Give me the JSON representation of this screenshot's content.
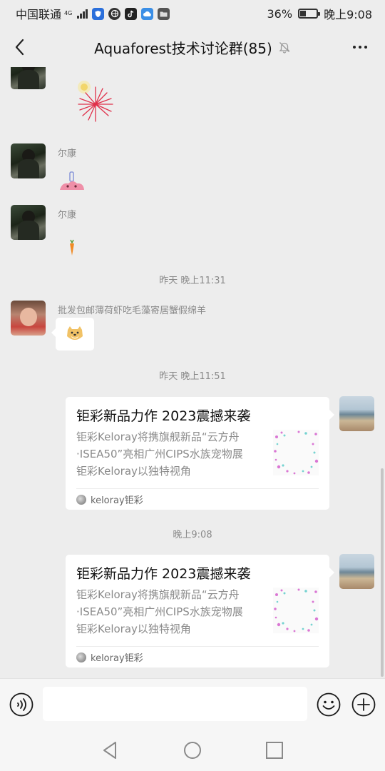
{
  "status_bar": {
    "carrier": "中国联通",
    "network": "4G",
    "battery_percent": "36%",
    "battery_level": 0.36,
    "time": "晚上9:08",
    "app_icons": [
      "shield-app-icon",
      "browser-app-icon",
      "tiktok-app-icon",
      "cloud-app-icon",
      "folder-app-icon"
    ]
  },
  "header": {
    "title": "Aquaforest技术讨论群(85)",
    "icons": [
      "back-icon",
      "mute-bell-icon",
      "more-icon"
    ]
  },
  "messages": [
    {
      "type": "sticker",
      "side": "left",
      "sticker": "firework-sticker"
    },
    {
      "type": "sticker",
      "side": "left",
      "sender": "尔康",
      "sticker": "pink-blob-sticker"
    },
    {
      "type": "sticker",
      "side": "left",
      "sender": "尔康",
      "sticker": "carrot-sticker"
    },
    {
      "type": "time",
      "text": "昨天 晚上11:31"
    },
    {
      "type": "sticker",
      "side": "left",
      "sender": "批发包邮薄荷虾吃毛藻寄居蟹假绵羊",
      "sticker": "doge-sticker"
    },
    {
      "type": "time",
      "text": "昨天 晚上11:51"
    },
    {
      "type": "link",
      "side": "right",
      "title": "钜彩新品力作 2023震撼来袭",
      "desc": [
        "钜彩Keloray将携旗舰新品“云方舟",
        "·ISEA50”亮相广州CIPS水族宠物展",
        "钜彩Keloray以独特视角"
      ],
      "source": "keloray钜彩"
    },
    {
      "type": "time",
      "text": "晚上9:08"
    },
    {
      "type": "link",
      "side": "right",
      "title": "钜彩新品力作 2023震撼来袭",
      "desc": [
        "钜彩Keloray将携旗舰新品“云方舟",
        "·ISEA50”亮相广州CIPS水族宠物展",
        "钜彩Keloray以独特视角"
      ],
      "source": "keloray钜彩"
    }
  ],
  "input_bar": {
    "value": "",
    "icons": [
      "voice-icon",
      "emoji-icon",
      "plus-icon"
    ]
  },
  "nav_bar": {
    "icons": [
      "nav-back-icon",
      "nav-home-icon",
      "nav-recent-icon"
    ]
  },
  "colors": {
    "background": "#ededed",
    "bubble": "#ffffff",
    "secondary_text": "#8a8a8a"
  }
}
